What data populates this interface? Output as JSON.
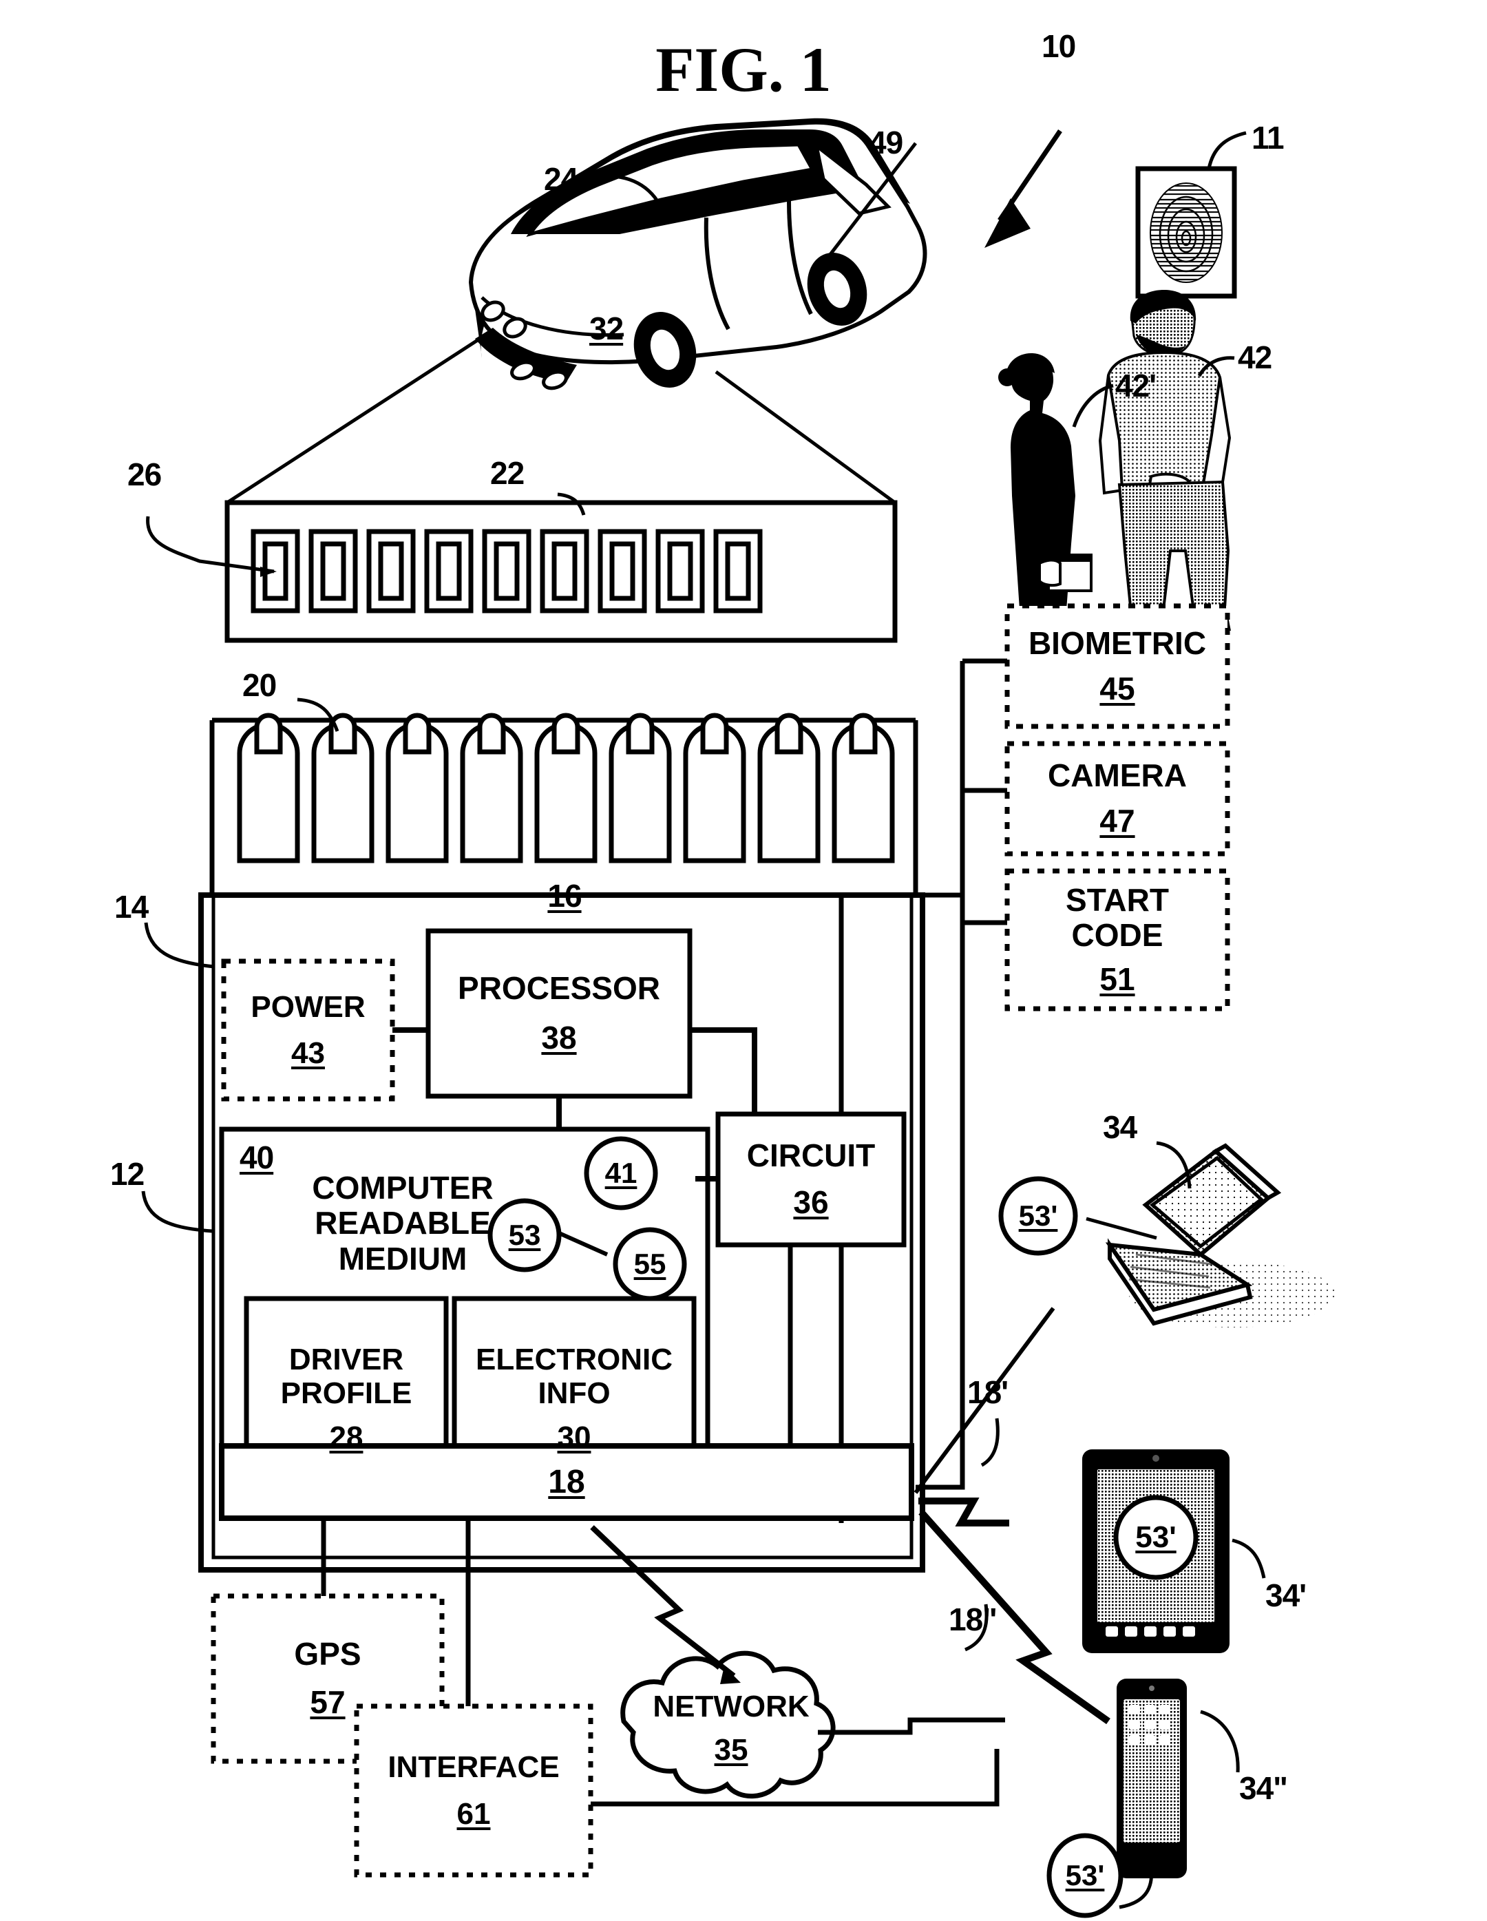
{
  "figure": {
    "title": "FIG. 1",
    "domain_type": "patent-diagram"
  },
  "reference_numerals": {
    "system": "10",
    "fingerprint": "11",
    "control_unit": "12",
    "housing": "14",
    "ampule_tray": "16",
    "bus": "18",
    "link_laptop": "18'",
    "link_phone": "18\"",
    "ampule": "20",
    "rack": "22",
    "vehicle": "24",
    "rack_slot": "26",
    "driver_profile": "28",
    "electronic_info": "30",
    "vehicle_body": "32",
    "laptop": "34",
    "tablet": "34'",
    "phone": "34\"",
    "network": "35",
    "circuit": "36",
    "processor": "38",
    "computer_readable_medium": "40",
    "code_41": "41",
    "person_male": "42",
    "person_female": "42'",
    "power": "43",
    "biometric": "45",
    "camera": "47",
    "antenna": "49",
    "start_code": "51",
    "code_53": "53",
    "code_53p": "53'",
    "code_55": "55",
    "gps": "57",
    "interface": "61"
  },
  "blocks": {
    "power": {
      "label": "POWER",
      "num": "43",
      "style": "dashed"
    },
    "processor": {
      "label": "PROCESSOR",
      "num": "38",
      "style": "solid"
    },
    "crm": {
      "label_line1": "COMPUTER",
      "label_line2": "READABLE",
      "label_line3": "MEDIUM",
      "num": "40",
      "style": "solid"
    },
    "driver_profile": {
      "label_line1": "DRIVER",
      "label_line2": "PROFILE",
      "num": "28",
      "style": "solid"
    },
    "electronic_info": {
      "label_line1": "ELECTRONIC",
      "label_line2": "INFO",
      "num": "30",
      "style": "solid"
    },
    "circuit": {
      "label": "CIRCUIT",
      "num": "36",
      "style": "solid"
    },
    "bus": {
      "num": "18",
      "style": "solid"
    },
    "biometric": {
      "label": "BIOMETRIC",
      "num": "45",
      "style": "dashed"
    },
    "camera": {
      "label": "CAMERA",
      "num": "47",
      "style": "dashed"
    },
    "start_code": {
      "label_line1": "START",
      "label_line2": "CODE",
      "num": "51",
      "style": "dashed"
    },
    "gps": {
      "label": "GPS",
      "num": "57",
      "style": "dashed"
    },
    "interface": {
      "label": "INTERFACE",
      "num": "61",
      "style": "dashed"
    },
    "network": {
      "label": "NETWORK",
      "num": "35",
      "style": "cloud"
    },
    "tray": {
      "num": "16",
      "style": "solid"
    },
    "rack": {
      "num": "22",
      "style": "solid"
    }
  },
  "circles": {
    "c41": "41",
    "c53": "53",
    "c55": "55",
    "c53_laptop": "53'",
    "c53_tablet": "53'",
    "c53_phone": "53'"
  },
  "leader_labels": {
    "l10": "10",
    "l11": "11",
    "l12": "12",
    "l14": "14",
    "l18p": "18'",
    "l18pp": "18\"",
    "l20": "20",
    "l22": "22",
    "l24": "24",
    "l26": "26",
    "l32": "32",
    "l34": "34",
    "l34p": "34'",
    "l34pp": "34\"",
    "l42": "42",
    "l42p": "42'",
    "l49": "49"
  },
  "counts": {
    "rack_slots": 9,
    "ampules": 9
  },
  "colors": {
    "ink": "#000000",
    "paper": "#ffffff"
  }
}
